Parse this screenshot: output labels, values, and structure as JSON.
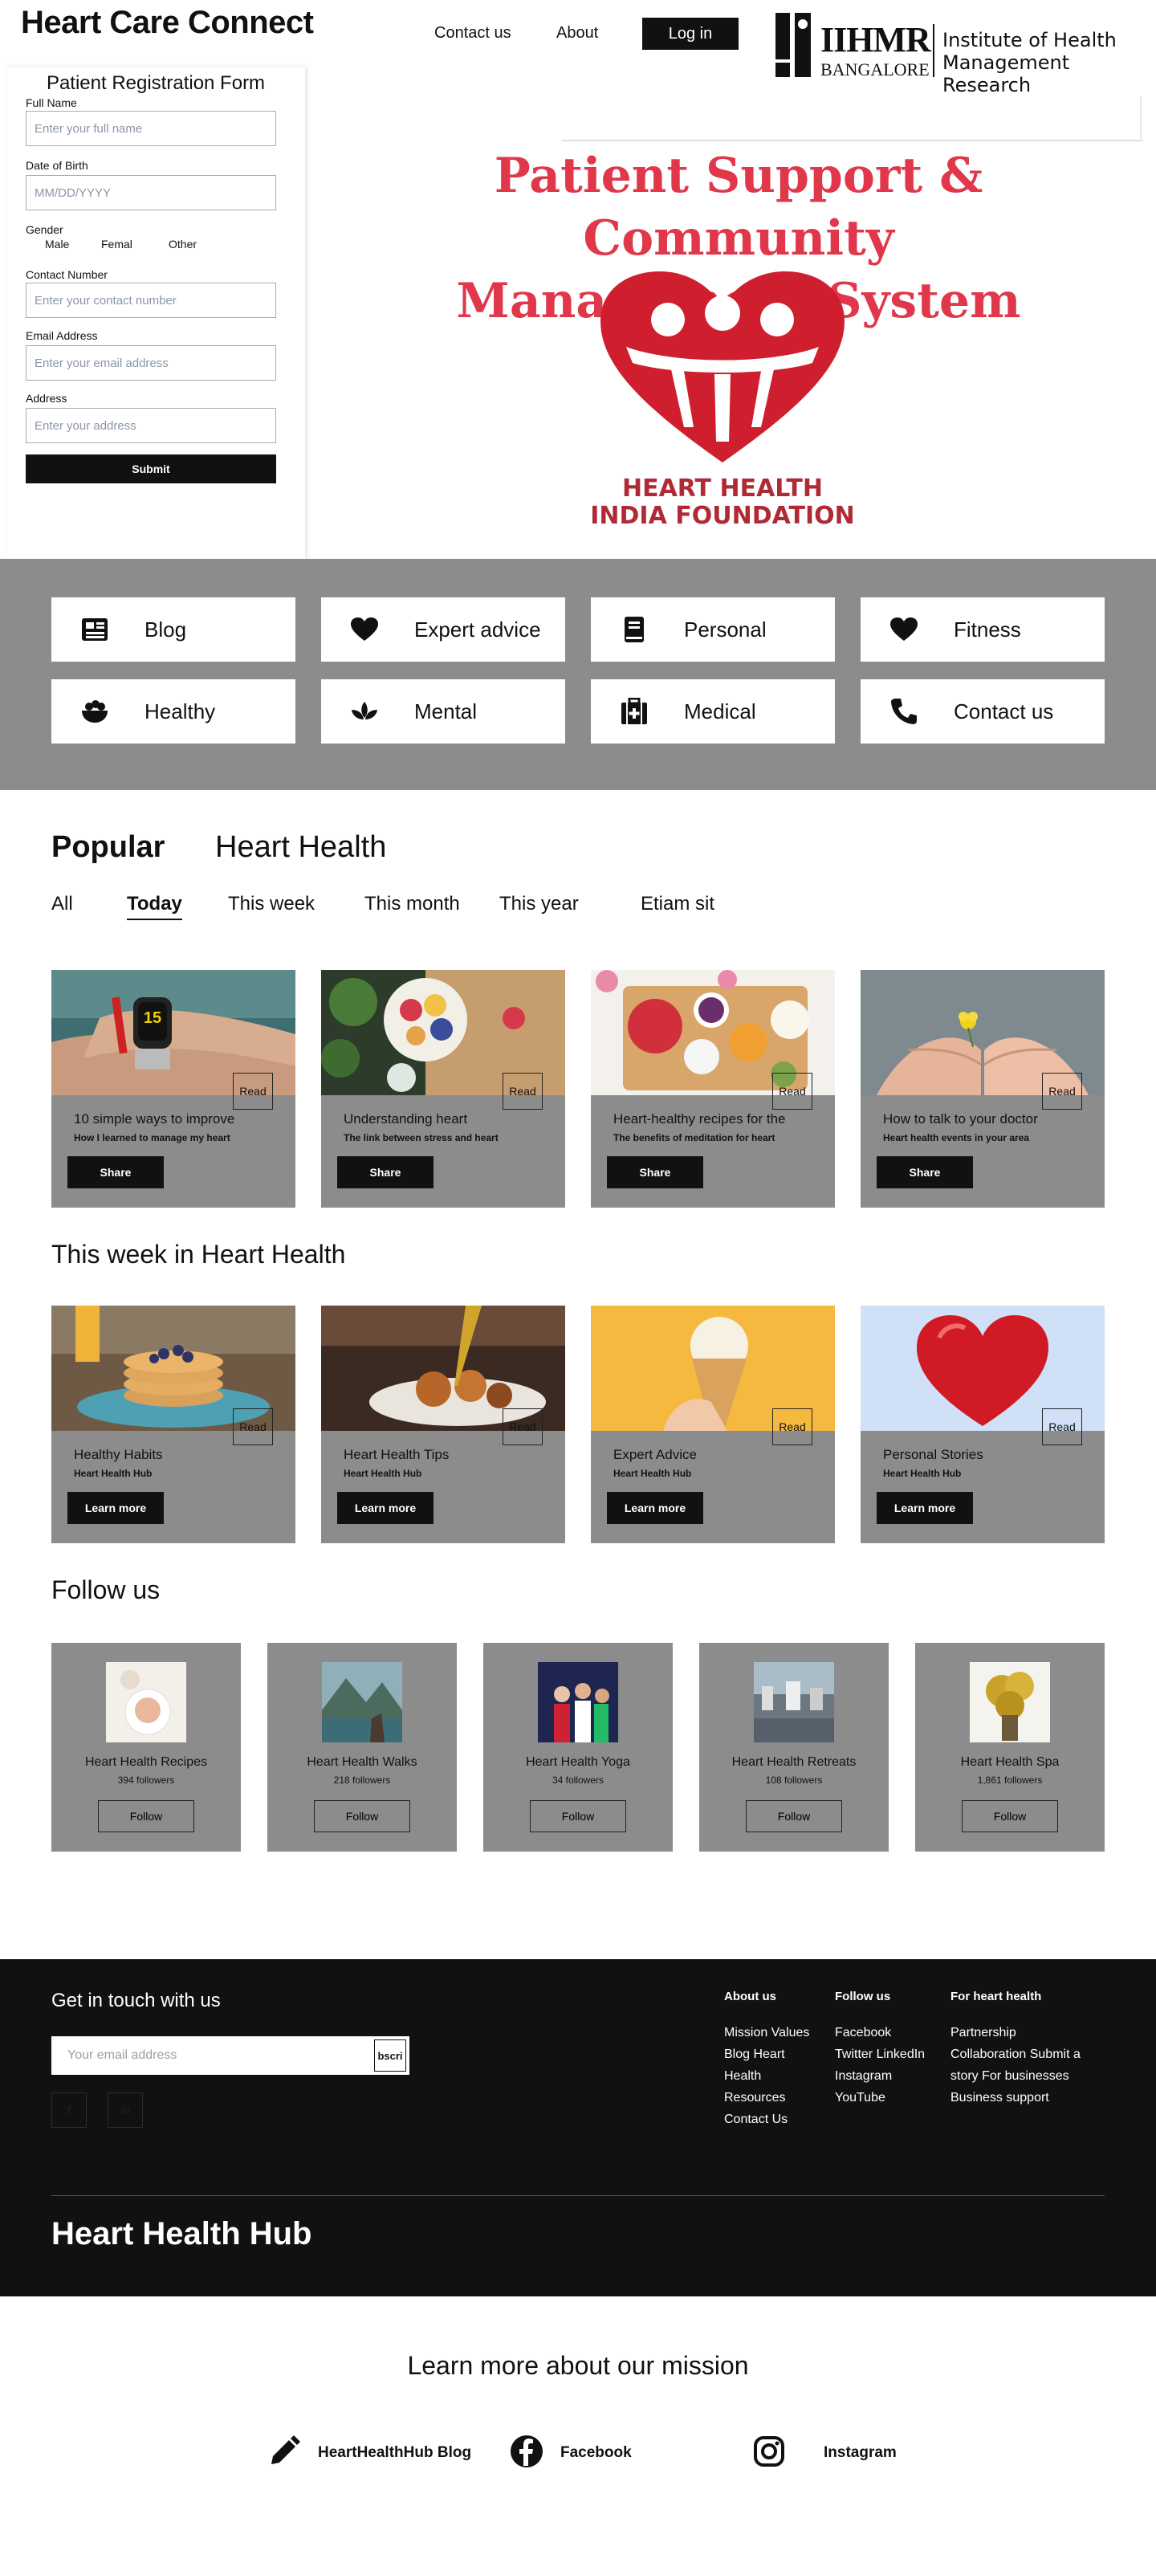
{
  "header": {
    "brand": "Heart Care Connect",
    "nav": {
      "contact": "Contact us",
      "about": "About",
      "login": "Log in"
    },
    "logo": {
      "title": "IIHMR",
      "sub": "BANGALORE",
      "line1": "Institute of Health",
      "line2": "Management Research"
    }
  },
  "form": {
    "title": "Patient Registration Form",
    "full_name": {
      "label": "Full Name",
      "placeholder": "Enter your full name"
    },
    "dob": {
      "label": "Date of Birth",
      "placeholder": "MM/DD/YYYY"
    },
    "gender": {
      "label": "Gender",
      "options": [
        "Male",
        "Femal",
        "Other"
      ]
    },
    "contact": {
      "label": "Contact Number",
      "placeholder": "Enter your contact number"
    },
    "email": {
      "label": "Email Address",
      "placeholder": "Enter your email address"
    },
    "address": {
      "label": "Address",
      "placeholder": "Enter your address"
    },
    "submit": "Submit"
  },
  "hero": {
    "title_line1": "Patient Support & Community",
    "title_line2": "Management System",
    "logo_line1": "HEART HEALTH",
    "logo_line2": "INDIA FOUNDATION"
  },
  "categories": [
    {
      "label": "Blog",
      "icon": "newspaper-icon"
    },
    {
      "label": "Expert advice",
      "icon": "heart-icon"
    },
    {
      "label": "Personal",
      "icon": "book-icon"
    },
    {
      "label": "Fitness",
      "icon": "heart-icon"
    },
    {
      "label": "Healthy",
      "icon": "bowl-icon"
    },
    {
      "label": "Mental",
      "icon": "lotus-icon"
    },
    {
      "label": "Medical",
      "icon": "medical-kit-icon"
    },
    {
      "label": "Contact us",
      "icon": "phone-icon"
    }
  ],
  "popular": {
    "title": "Popular",
    "subtitle": "Heart Health",
    "tabs": [
      "All",
      "Today",
      "This week",
      "This month",
      "This year",
      "Etiam sit"
    ],
    "active_tab": "Today",
    "cards": [
      {
        "title": "10 simple ways to improve",
        "sub": "How I learned to manage my heart",
        "button": "Share",
        "read": "Read"
      },
      {
        "title": "Understanding heart",
        "sub": "The link between stress and heart",
        "button": "Share",
        "read": "Read"
      },
      {
        "title": "Heart-healthy recipes for the",
        "sub": "The benefits of meditation for heart",
        "button": "Share",
        "read": "Read"
      },
      {
        "title": "How to talk to your doctor",
        "sub": "Heart health events in your area",
        "button": "Share",
        "read": "Read"
      }
    ]
  },
  "week": {
    "title": "This week in Heart Health",
    "cards": [
      {
        "title": "Healthy Habits",
        "sub": "Heart Health Hub",
        "button": "Learn more",
        "read": "Read"
      },
      {
        "title": "Heart Health Tips",
        "sub": "Heart Health Hub",
        "button": "Learn more",
        "read": "Read"
      },
      {
        "title": "Expert Advice",
        "sub": "Heart Health Hub",
        "button": "Learn more",
        "read": "Read"
      },
      {
        "title": "Personal Stories",
        "sub": "Heart Health Hub",
        "button": "Learn more",
        "read": "Read"
      }
    ]
  },
  "follow": {
    "title": "Follow us",
    "cards": [
      {
        "name": "Heart Health Recipes",
        "followers": "394 followers",
        "button": "Follow"
      },
      {
        "name": "Heart Health Walks",
        "followers": "218 followers",
        "button": "Follow"
      },
      {
        "name": "Heart Health Yoga",
        "followers": "34 followers",
        "button": "Follow"
      },
      {
        "name": "Heart Health Retreats",
        "followers": "108 followers",
        "button": "Follow"
      },
      {
        "name": "Heart Health Spa",
        "followers": "1,861 followers",
        "button": "Follow"
      }
    ]
  },
  "footer": {
    "get_in_touch": "Get in touch with us",
    "email_placeholder": "Your email address",
    "subscribe": "bscri",
    "social": [
      "f",
      "in"
    ],
    "col1": {
      "title": "About us",
      "links": [
        "Mission Values",
        "Blog Heart",
        "Health",
        "Resources",
        "Contact Us"
      ]
    },
    "col2": {
      "title": "Follow us",
      "links": [
        "Facebook",
        "Twitter LinkedIn",
        "Instagram",
        "YouTube"
      ]
    },
    "col3": {
      "title": "For heart health",
      "links": [
        "Partnership",
        "Collaboration Submit a",
        "story For businesses",
        "Business support"
      ]
    },
    "brand": "Heart Health Hub"
  },
  "mission": {
    "title": "Learn more about our mission",
    "links": [
      {
        "label": "HeartHealthHub Blog",
        "icon": "pencil-icon"
      },
      {
        "label": "Facebook",
        "icon": "facebook-icon"
      },
      {
        "label": "Instagram",
        "icon": "instagram-icon"
      }
    ]
  },
  "colors": {
    "accent": "#e0374a",
    "band": "#8c8c8c",
    "dark": "#111111"
  }
}
